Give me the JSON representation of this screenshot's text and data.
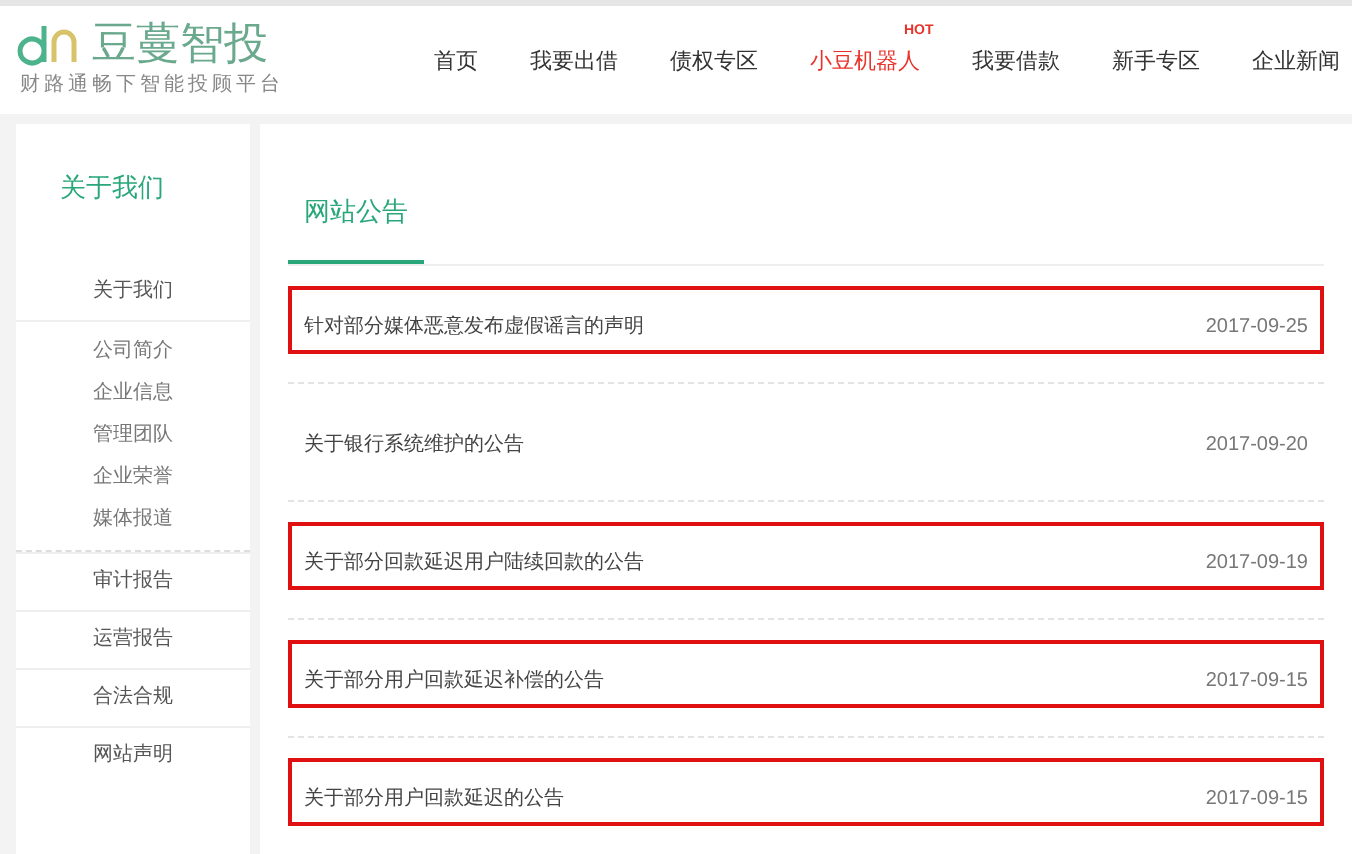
{
  "logo": {
    "name": "豆蔓智投",
    "slogan": "财路通畅下智能投顾平台"
  },
  "nav": [
    {
      "label": "首页",
      "hot": false
    },
    {
      "label": "我要出借",
      "hot": false
    },
    {
      "label": "债权专区",
      "hot": false
    },
    {
      "label": "小豆机器人",
      "hot": true,
      "badge": "HOT"
    },
    {
      "label": "我要借款",
      "hot": false
    },
    {
      "label": "新手专区",
      "hot": false
    },
    {
      "label": "企业新闻",
      "hot": false
    }
  ],
  "sidebar": {
    "title": "关于我们",
    "sections": [
      {
        "label": "关于我们",
        "children": [
          {
            "label": "公司简介"
          },
          {
            "label": "企业信息"
          },
          {
            "label": "管理团队"
          },
          {
            "label": "企业荣誉"
          },
          {
            "label": "媒体报道"
          }
        ]
      },
      {
        "label": "审计报告"
      },
      {
        "label": "运营报告"
      },
      {
        "label": "合法合规"
      },
      {
        "label": "网站声明"
      }
    ]
  },
  "main": {
    "title": "网站公告",
    "notices": [
      {
        "title": "针对部分媒体恶意发布虚假谣言的声明",
        "date": "2017-09-25",
        "highlighted": true
      },
      {
        "title": "关于银行系统维护的公告",
        "date": "2017-09-20",
        "highlighted": false
      },
      {
        "title": "关于部分回款延迟用户陆续回款的公告",
        "date": "2017-09-19",
        "highlighted": true
      },
      {
        "title": "关于部分用户回款延迟补偿的公告",
        "date": "2017-09-15",
        "highlighted": true
      },
      {
        "title": "关于部分用户回款延迟的公告",
        "date": "2017-09-15",
        "highlighted": true
      }
    ]
  }
}
